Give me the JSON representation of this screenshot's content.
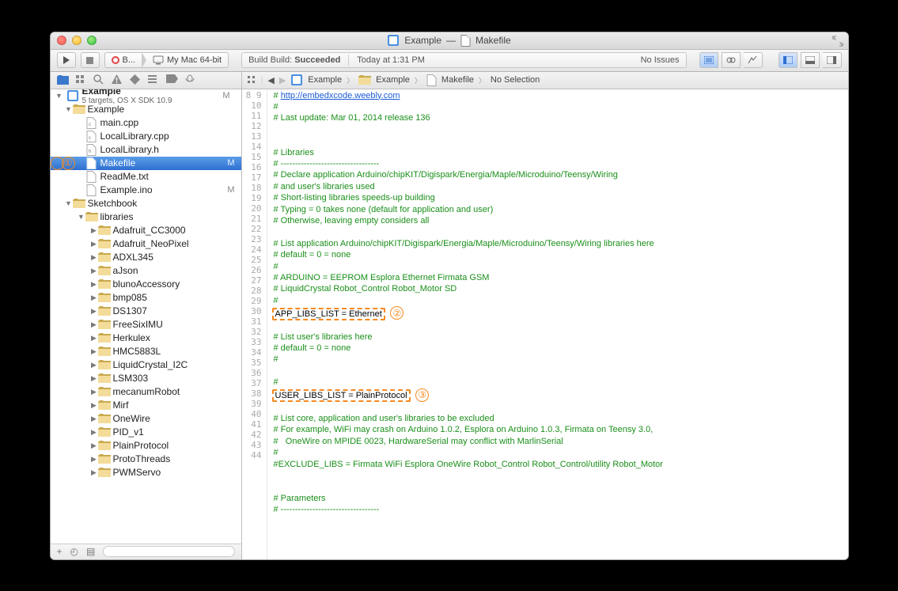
{
  "window": {
    "title_left": "Example",
    "title_sep": "—",
    "title_right": "Makefile"
  },
  "toolbar": {
    "scheme_name": "B...",
    "scheme_dest": "My Mac 64-bit",
    "status_build": "Build Build:",
    "status_result": "Succeeded",
    "status_time": "Today at 1:31 PM",
    "status_issues": "No Issues"
  },
  "project": {
    "name": "Example",
    "subtitle": "5 targets, OS X SDK 10.9",
    "mod": "M"
  },
  "files": {
    "folder": "Example",
    "main": "main.cpp",
    "localcpp": "LocalLibrary.cpp",
    "localh": "LocalLibrary.h",
    "makefile": "Makefile",
    "readme": "ReadMe.txt",
    "ino": "Example.ino",
    "mod": "M",
    "sketchbook": "Sketchbook",
    "libraries": "libraries",
    "libs": [
      "Adafruit_CC3000",
      "Adafruit_NeoPixel",
      "ADXL345",
      "aJson",
      "blunoAccessory",
      "bmp085",
      "DS1307",
      "FreeSixIMU",
      "Herkulex",
      "HMC5883L",
      "LiquidCrystal_I2C",
      "LSM303",
      "mecanumRobot",
      "Mirf",
      "OneWire",
      "PID_v1",
      "PlainProtocol",
      "ProtoThreads",
      "PWMServo"
    ]
  },
  "jump": {
    "p1": "Example",
    "p2": "Example",
    "p3": "Makefile",
    "p4": "No Selection"
  },
  "code": {
    "start": 8,
    "url": "http://embedxcode.weebly.com",
    "lines": [
      "# @url",
      "#",
      "# Last update: Mar 01, 2014 release 136",
      "",
      "",
      "# Libraries",
      "# ----------------------------------",
      "# Declare application Arduino/chipKIT/Digispark/Energia/Maple/Microduino/Teensy/Wiring",
      "# and user's libraries used",
      "# Short-listing libraries speeds-up building",
      "# Typing = 0 takes none (default for application and user)",
      "# Otherwise, leaving empty considers all",
      "",
      "# List application Arduino/chipKIT/Digispark/Energia/Maple/Microduino/Teensy/Wiring libraries here",
      "# default = 0 = none",
      "#",
      "# ARDUINO = EEPROM Esplora Ethernet Firmata GSM",
      "# LiquidCrystal Robot_Control Robot_Motor SD",
      "#",
      "@hl:APP_LIBS_LIST = Ethernet|2",
      "",
      "# List user's libraries here",
      "# default = 0 = none",
      "#",
      "",
      "#",
      "@hl:USER_LIBS_LIST = PlainProtocol|3",
      "",
      "# List core, application and user's libraries to be excluded",
      "# For example, WiFi may crash on Arduino 1.0.2, Esplora on Arduino 1.0.3, Firmata on Teensy 3.0,",
      "#   OneWire on MPIDE 0023, HardwareSerial may conflict with MarlinSerial",
      "#",
      "#EXCLUDE_LIBS = Firmata WiFi Esplora OneWire Robot_Control Robot_Control/utility Robot_Motor",
      "",
      "",
      "# Parameters",
      "# ----------------------------------"
    ]
  },
  "callout1_row": "Makefile"
}
